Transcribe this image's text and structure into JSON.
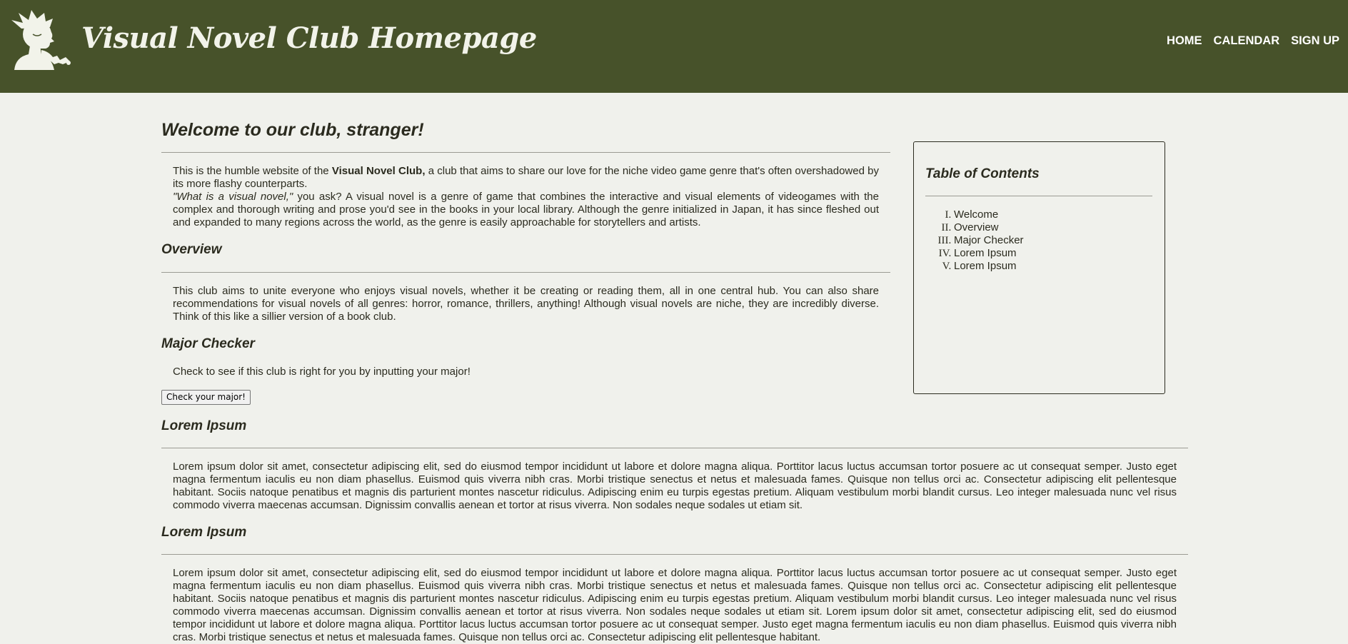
{
  "header": {
    "site_title": "Visual Novel Club Homepage",
    "logo_icon": "girl-silhouette-icon",
    "nav": [
      "HOME",
      "CALENDAR",
      "SIGN UP"
    ]
  },
  "welcome": {
    "heading": "Welcome to our club, stranger!",
    "p1_before": "This is the humble website of the ",
    "p1_bold": "Visual Novel Club,",
    "p1_after": " a club that aims to share our love for the niche video game genre that's often overshadowed by its more flashy counterparts.",
    "p2_italic": "\"What is a visual novel,\"",
    "p2_after": " you ask? A visual novel is a genre of game that combines the interactive and visual elements of videogames with the complex and thorough writing and prose you'd see in the books in your local library. Although the genre initialized in Japan, it has since fleshed out and expanded to many regions across the world, as the genre is easily approachable for storytellers and artists."
  },
  "overview": {
    "heading": "Overview",
    "text": "This club aims to unite everyone who enjoys visual novels, whether it be creating or reading them, all in one central hub. You can also share recommendations for visual novels of all genres: horror, romance, thrillers, anything! Although visual novels are niche, they are incredibly diverse. Think of this like a sillier version of a book club."
  },
  "major_checker": {
    "heading": "Major Checker",
    "text": "Check to see if this club is right for you by inputting your major!",
    "button_label": "Check your major!"
  },
  "toc": {
    "heading": "Table of Contents",
    "items": [
      "Welcome",
      "Overview",
      "Major Checker",
      "Lorem Ipsum",
      "Lorem Ipsum"
    ]
  },
  "lorem1": {
    "heading": "Lorem Ipsum",
    "text": "Lorem ipsum dolor sit amet, consectetur adipiscing elit, sed do eiusmod tempor incididunt ut labore et dolore magna aliqua. Porttitor lacus luctus accumsan tortor posuere ac ut consequat semper. Justo eget magna fermentum iaculis eu non diam phasellus. Euismod quis viverra nibh cras. Morbi tristique senectus et netus et malesuada fames. Quisque non tellus orci ac. Consectetur adipiscing elit pellentesque habitant. Sociis natoque penatibus et magnis dis parturient montes nascetur ridiculus. Adipiscing enim eu turpis egestas pretium. Aliquam vestibulum morbi blandit cursus. Leo integer malesuada nunc vel risus commodo viverra maecenas accumsan. Dignissim convallis aenean et tortor at risus viverra. Non sodales neque sodales ut etiam sit."
  },
  "lorem2": {
    "heading": "Lorem Ipsum",
    "text": "Lorem ipsum dolor sit amet, consectetur adipiscing elit, sed do eiusmod tempor incididunt ut labore et dolore magna aliqua. Porttitor lacus luctus accumsan tortor posuere ac ut consequat semper. Justo eget magna fermentum iaculis eu non diam phasellus. Euismod quis viverra nibh cras. Morbi tristique senectus et netus et malesuada fames. Quisque non tellus orci ac. Consectetur adipiscing elit pellentesque habitant. Sociis natoque penatibus et magnis dis parturient montes nascetur ridiculus. Adipiscing enim eu turpis egestas pretium. Aliquam vestibulum morbi blandit cursus. Leo integer malesuada nunc vel risus commodo viverra maecenas accumsan. Dignissim convallis aenean et tortor at risus viverra. Non sodales neque sodales ut etiam sit. Lorem ipsum dolor sit amet, consectetur adipiscing elit, sed do eiusmod tempor incididunt ut labore et dolore magna aliqua. Porttitor lacus luctus accumsan tortor posuere ac ut consequat semper. Justo eget magna fermentum iaculis eu non diam phasellus. Euismod quis viverra nibh cras. Morbi tristique senectus et netus et malesuada fames. Quisque non tellus orci ac. Consectetur adipiscing elit pellentesque habitant."
  },
  "colors": {
    "header_bg": "#47522a",
    "page_bg": "#f0f1ec",
    "text": "#2b2b1f"
  }
}
